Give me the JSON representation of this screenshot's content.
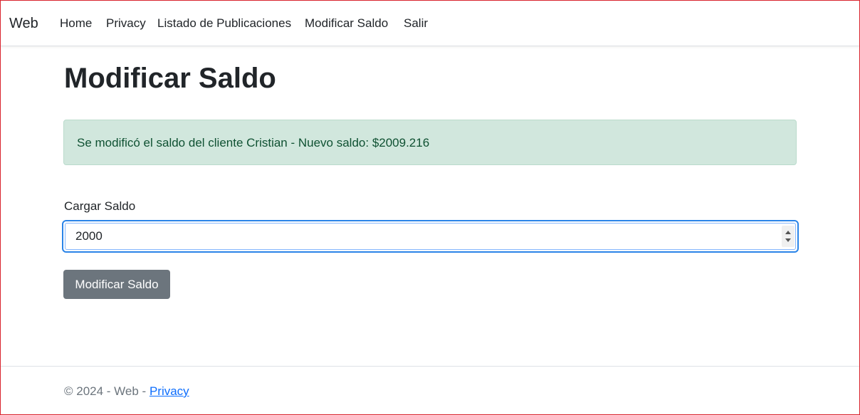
{
  "navbar": {
    "brand": "Web",
    "links": [
      "Home",
      "Privacy",
      "Listado de Publicaciones",
      "Modificar Saldo",
      "Salir"
    ]
  },
  "main": {
    "title": "Modificar Saldo",
    "alert": {
      "text": "Se modificó el saldo del cliente Cristian - Nuevo saldo: $2009.216",
      "type": "success"
    },
    "form": {
      "label": "Cargar Saldo",
      "input_value": "2000",
      "submit_label": "Modificar Saldo"
    }
  },
  "footer": {
    "text": "© 2024 - Web - ",
    "link": "Privacy"
  },
  "colors": {
    "alert_bg": "#d1e7dd",
    "alert_text": "#0f5132",
    "button_bg": "#6c757d",
    "focus_ring": "#2a84e8",
    "link": "#0d6efd"
  }
}
